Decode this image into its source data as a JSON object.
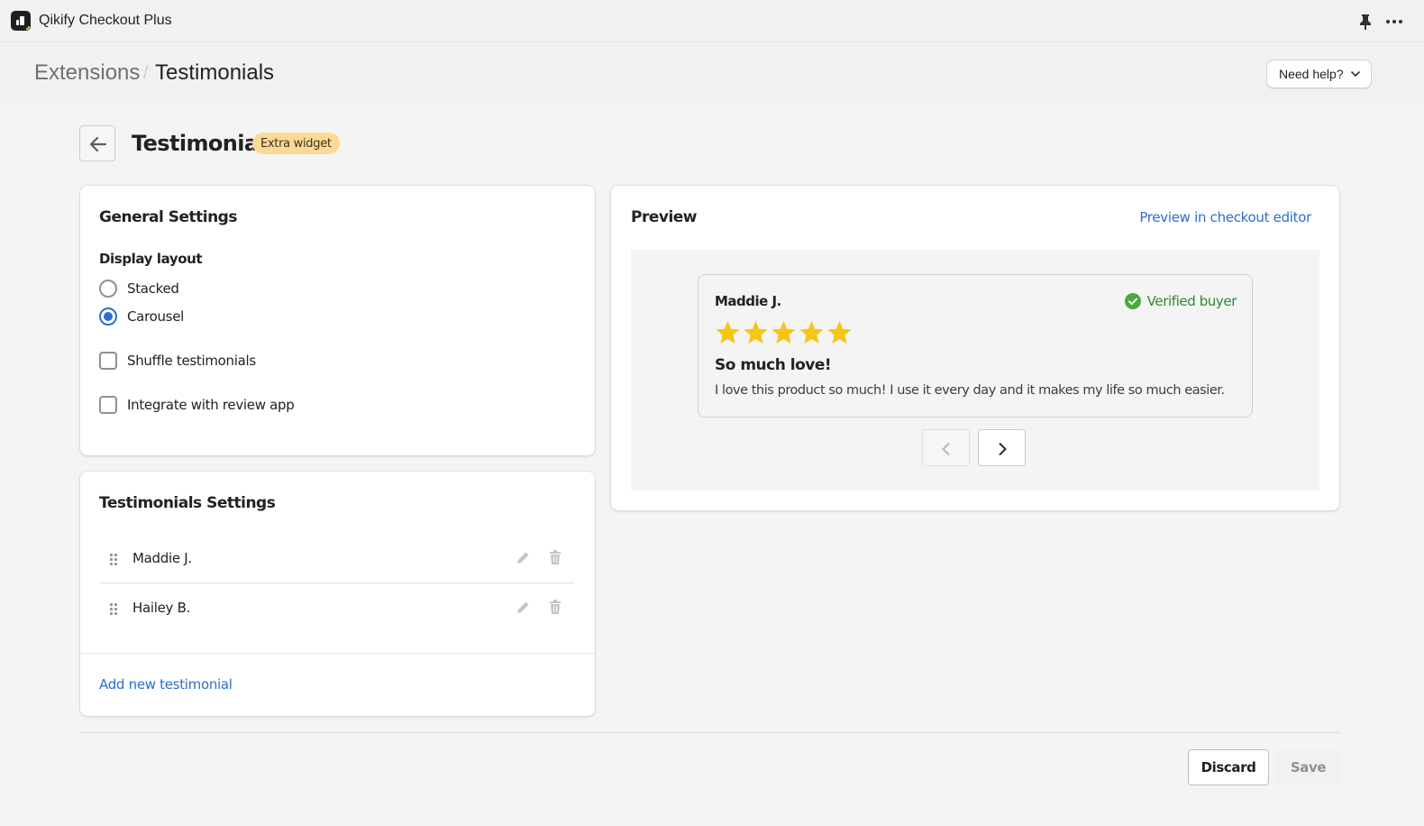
{
  "app": {
    "title": "Qikify Checkout Plus",
    "icons": {
      "pin": "pin-icon",
      "more": "more-horizontal-icon"
    }
  },
  "breadcrumb": {
    "items": [
      "Extensions",
      "Testimonials"
    ],
    "separator": "/"
  },
  "header": {
    "help_label": "Need help?"
  },
  "page": {
    "title": "Testimonials",
    "badge": "Extra widget",
    "badge_color": "#fcd995"
  },
  "general_settings": {
    "title": "General Settings",
    "display_layout_label": "Display layout",
    "layout_options": [
      {
        "label": "Stacked",
        "selected": false
      },
      {
        "label": "Carousel",
        "selected": true
      }
    ],
    "shuffle": {
      "label": "Shuffle testimonials",
      "checked": false
    },
    "integrate": {
      "label": "Integrate with review app",
      "checked": false
    }
  },
  "testimonials_settings": {
    "title": "Testimonials Settings",
    "items": [
      {
        "name": "Maddie J."
      },
      {
        "name": "Hailey B."
      }
    ],
    "add_label": "Add new testimonial"
  },
  "preview": {
    "title": "Preview",
    "link_label": "Preview in checkout editor",
    "review": {
      "name": "Maddie J.",
      "verified_label": "Verified buyer",
      "rating": 5,
      "rating_max": 5,
      "title": "So much love!",
      "body": "I love this product so much! I use it every day and it makes my life so much easier."
    },
    "colors": {
      "star": "#f5c518",
      "verified": "#2a8a2f",
      "accent": "#2c6ecb"
    }
  },
  "footer": {
    "discard_label": "Discard",
    "save_label": "Save",
    "save_enabled": false
  }
}
